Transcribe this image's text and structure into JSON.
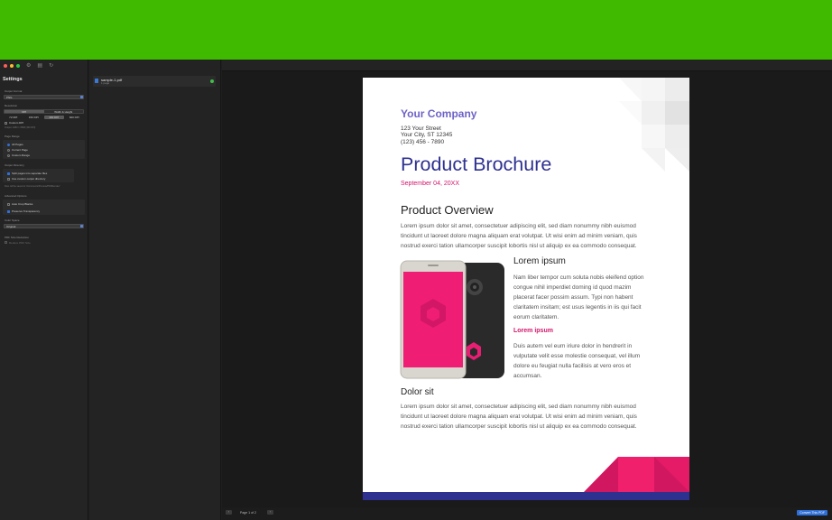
{
  "colors": {
    "background": "#3fba00",
    "accent": "#2f6fd6",
    "company": "#6d63c7",
    "title": "#2e3190",
    "pink": "#d1166b"
  },
  "sidebar": {
    "title": "Settings",
    "output_format": {
      "label": "Output Format",
      "value": "PNG"
    },
    "resolution": {
      "label": "Resolution",
      "modes": [
        "DPI",
        "Width & Height"
      ],
      "active_mode": "DPI",
      "dpi_options": [
        "72 DPI",
        "150 DPI",
        "300 DPI",
        "600 DPI"
      ],
      "active_dpi": "300 DPI",
      "custom_dpi_label": "Custom DPI",
      "output_note": "Output: 2480 × 3508 (300 DPI)"
    },
    "page_range": {
      "label": "Page Range",
      "options": [
        "All Pages",
        "Current Page",
        "Custom Range"
      ],
      "selected": "All Pages"
    },
    "output_directory": {
      "label": "Output Directory",
      "split_pages_label": "Split pages into separate files",
      "custom_dir_label": "Use custom output directory",
      "note": "Files will be saved to: Documents/Preview/PDFRender/"
    },
    "advanced": {
      "label": "Advanced Options",
      "auto_crop_label": "Auto Crop Blanks",
      "preserve_label": "Preserve Transparency"
    },
    "color_space": {
      "label": "Color Space",
      "value": "Original"
    },
    "size_reduction": {
      "label": "PDF Size Reduction",
      "reduce_label": "Reduce PDF Size"
    }
  },
  "files": [
    {
      "name": "sample-1.pdf",
      "subtitle": "1 page",
      "status": "ok"
    }
  ],
  "preview": {
    "page_label": "Page 1 of 2",
    "prev_icon": "chevron-left-icon",
    "next_icon": "chevron-right-icon",
    "convert_label": "Convert This PDF"
  },
  "document": {
    "company": "Your Company",
    "address": [
      "123 Your Street",
      "Your City, ST 12345",
      "(123) 456 - 7890"
    ],
    "title": "Product Brochure",
    "date": "September 04, 20XX",
    "overview_heading": "Product Overview",
    "overview_lines": [
      "Lorem ipsum dolor sit amet, consectetuer adipiscing elit, sed diam nonummy nibh euismod",
      "tincidunt ut laoreet dolore magna aliquam erat volutpat. Ut wisi enim ad minim veniam, quis",
      "nostrud exerci tation ullamcorper suscipit lobortis nisl ut aliquip ex ea commodo consequat."
    ],
    "lorem_heading": "Lorem ipsum",
    "lorem_lines": [
      "Nam liber tempor cum soluta nobis eleifend option",
      "congue nihil imperdiet doming id quod mazim",
      "placerat facer possim assum. Typi non habent",
      "claritatem insitam; est usus legentis in iis qui facit",
      "eorum claritatem."
    ],
    "lorem_subheading": "Lorem ipsum",
    "lorem2_lines": [
      "Duis autem vel eum iriure dolor in hendrerit in",
      "vulputate velit esse molestie consequat, vel illum",
      "dolore eu feugiat nulla facilisis at vero eros et",
      "accumsan."
    ],
    "dolor_heading": "Dolor sit",
    "dolor_lines": [
      "Lorem ipsum dolor sit amet, consectetuer adipiscing elit, sed diam nonummy nibh euismod",
      "tincidunt ut laoreet dolore magna aliquam erat volutpat. Ut wisi enim ad minim veniam, quis",
      "nostrud exerci tation ullamcorper suscipit lobortis nisl ut aliquip ex ea commodo consequat."
    ]
  }
}
